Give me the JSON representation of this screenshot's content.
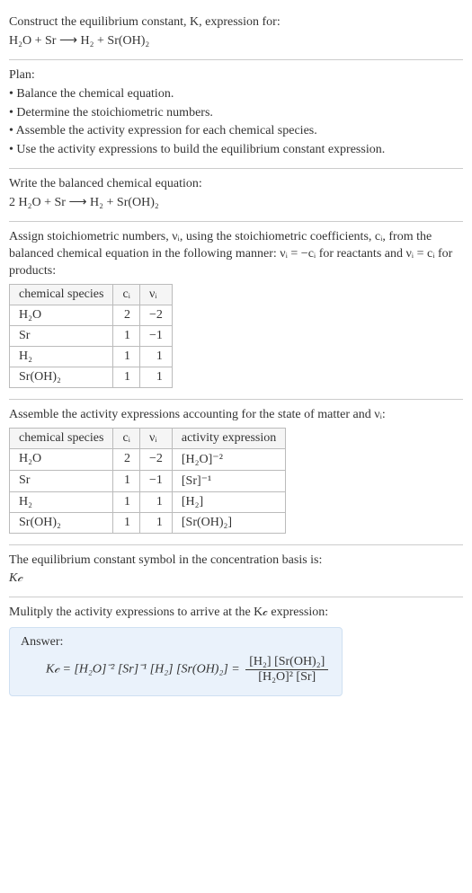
{
  "intro": {
    "line1": "Construct the equilibrium constant, K, expression for:",
    "equation": "H₂O + Sr ⟶ H₂ + Sr(OH)₂"
  },
  "plan": {
    "heading": "Plan:",
    "items": [
      "• Balance the chemical equation.",
      "• Determine the stoichiometric numbers.",
      "• Assemble the activity expression for each chemical species.",
      "• Use the activity expressions to build the equilibrium constant expression."
    ]
  },
  "balanced": {
    "heading": "Write the balanced chemical equation:",
    "equation": "2 H₂O + Sr ⟶ H₂ + Sr(OH)₂"
  },
  "stoich": {
    "text1": "Assign stoichiometric numbers, νᵢ, using the stoichiometric coefficients, cᵢ, from the balanced chemical equation in the following manner: νᵢ = −cᵢ for reactants and νᵢ = cᵢ for products:",
    "headers": [
      "chemical species",
      "cᵢ",
      "νᵢ"
    ],
    "rows": [
      {
        "species": "H₂O",
        "c": "2",
        "v": "−2"
      },
      {
        "species": "Sr",
        "c": "1",
        "v": "−1"
      },
      {
        "species": "H₂",
        "c": "1",
        "v": "1"
      },
      {
        "species": "Sr(OH)₂",
        "c": "1",
        "v": "1"
      }
    ]
  },
  "activity": {
    "text": "Assemble the activity expressions accounting for the state of matter and νᵢ:",
    "headers": [
      "chemical species",
      "cᵢ",
      "νᵢ",
      "activity expression"
    ],
    "rows": [
      {
        "species": "H₂O",
        "c": "2",
        "v": "−2",
        "a": "[H₂O]⁻²"
      },
      {
        "species": "Sr",
        "c": "1",
        "v": "−1",
        "a": "[Sr]⁻¹"
      },
      {
        "species": "H₂",
        "c": "1",
        "v": "1",
        "a": "[H₂]"
      },
      {
        "species": "Sr(OH)₂",
        "c": "1",
        "v": "1",
        "a": "[Sr(OH)₂]"
      }
    ]
  },
  "symbol": {
    "text": "The equilibrium constant symbol in the concentration basis is:",
    "value": "K𝒸"
  },
  "final": {
    "text": "Mulitply the activity expressions to arrive at the K𝒸 expression:",
    "answer_label": "Answer:",
    "lhs": "K𝒸 = [H₂O]⁻² [Sr]⁻¹ [H₂] [Sr(OH)₂] =",
    "frac_num": "[H₂] [Sr(OH)₂]",
    "frac_den": "[H₂O]² [Sr]"
  },
  "chart_data": {
    "type": "table",
    "tables": [
      {
        "title": "stoichiometric numbers",
        "columns": [
          "chemical species",
          "c_i",
          "nu_i"
        ],
        "rows": [
          [
            "H2O",
            2,
            -2
          ],
          [
            "Sr",
            1,
            -1
          ],
          [
            "H2",
            1,
            1
          ],
          [
            "Sr(OH)2",
            1,
            1
          ]
        ]
      },
      {
        "title": "activity expressions",
        "columns": [
          "chemical species",
          "c_i",
          "nu_i",
          "activity expression"
        ],
        "rows": [
          [
            "H2O",
            2,
            -2,
            "[H2O]^-2"
          ],
          [
            "Sr",
            1,
            -1,
            "[Sr]^-1"
          ],
          [
            "H2",
            1,
            1,
            "[H2]"
          ],
          [
            "Sr(OH)2",
            1,
            1,
            "[Sr(OH)2]"
          ]
        ]
      }
    ],
    "equilibrium_constant": "K_c = ([H2][Sr(OH)2]) / ([H2O]^2 [Sr])"
  }
}
